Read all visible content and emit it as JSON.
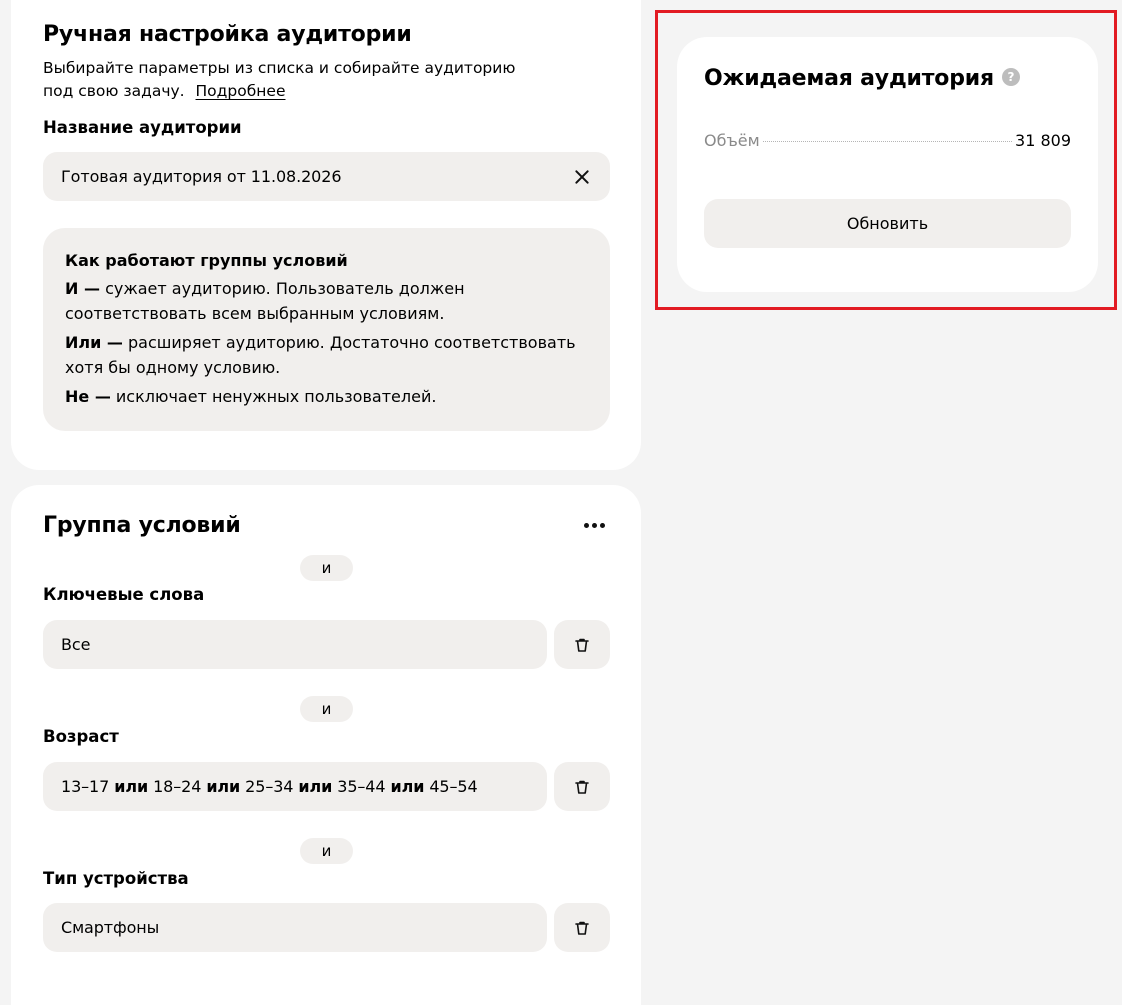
{
  "manual": {
    "title": "Ручная настройка аудитории",
    "description_line1": "Выбирайте параметры из списка и собирайте аудиторию",
    "description_line2": "под свою задачу.",
    "more_link": "Подробнее",
    "name_label": "Название аудитории",
    "name_value": "Готовая аудитория от 11.08.2026",
    "info": {
      "title": "Как работают группы условий",
      "and_key": "И —",
      "and_text": "сужает аудиторию. Пользователь должен соответствовать всем выбранным условиям.",
      "or_key": "Или —",
      "or_text": "расширяет аудиторию. Достаточно соответствовать хотя бы одному условию.",
      "not_key": "Не —",
      "not_text": "исключает ненужных пользователей."
    }
  },
  "group": {
    "title": "Группа условий",
    "connector": "и",
    "conditions": [
      {
        "label": "Ключевые слова",
        "value": "Все"
      },
      {
        "label": "Возраст",
        "age_values": [
          "13–17",
          "18–24",
          "25–34",
          "35–44",
          "45–54"
        ],
        "joiner": "или"
      },
      {
        "label": "Тип устройства",
        "value": "Смартфоны"
      }
    ]
  },
  "expected": {
    "title": "Ожидаемая аудитория",
    "help_glyph": "?",
    "volume_label": "Объём",
    "volume_value": "31 809",
    "update_button": "Обновить"
  },
  "colors": {
    "highlight_border": "#e21b23",
    "field_bg": "#f1efed",
    "page_bg": "#f4f4f4"
  },
  "icons": [
    "close-icon",
    "trash-icon",
    "more-dots-icon",
    "help-icon"
  ]
}
